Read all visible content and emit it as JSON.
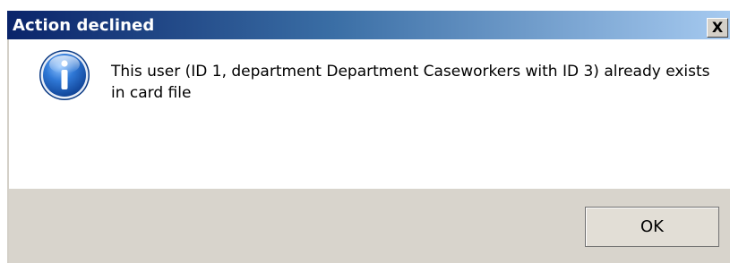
{
  "window": {
    "title": "Action declined",
    "close_label": "X"
  },
  "message": {
    "icon": "info-icon",
    "text": "This user (ID 1, department Department Caseworkers with ID 3) already exists in card file"
  },
  "buttons": {
    "ok_label": "OK"
  },
  "colors": {
    "titlebar_start": "#0a246a",
    "titlebar_end": "#a6caf0",
    "footer_bg": "#d8d4cc",
    "icon_blue": "#1f5fb8"
  }
}
